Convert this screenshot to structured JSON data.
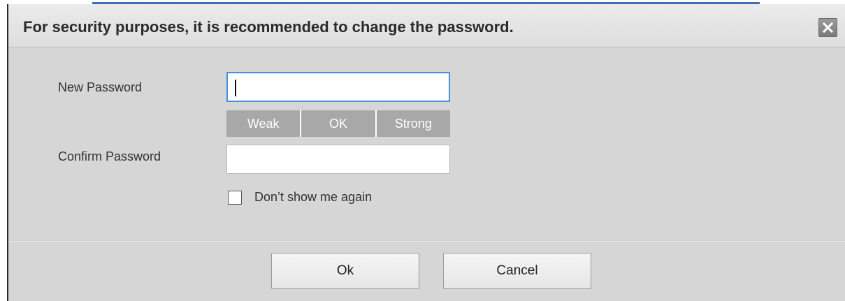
{
  "dialog": {
    "title": "For security purposes, it is recommended to change the password.",
    "close_icon": "close-x-icon"
  },
  "form": {
    "new_password_label": "New Password",
    "new_password_value": "",
    "strength": {
      "weak": "Weak",
      "ok": "OK",
      "strong": "Strong"
    },
    "confirm_password_label": "Confirm Password",
    "confirm_password_value": "",
    "dont_show_label": "Don’t show me again",
    "dont_show_checked": false
  },
  "buttons": {
    "ok_label": "Ok",
    "cancel_label": "Cancel"
  },
  "colors": {
    "focus_border": "#4a90e2",
    "dialog_bg": "#d6d6d6",
    "strength_bg": "#a8a8a8"
  }
}
